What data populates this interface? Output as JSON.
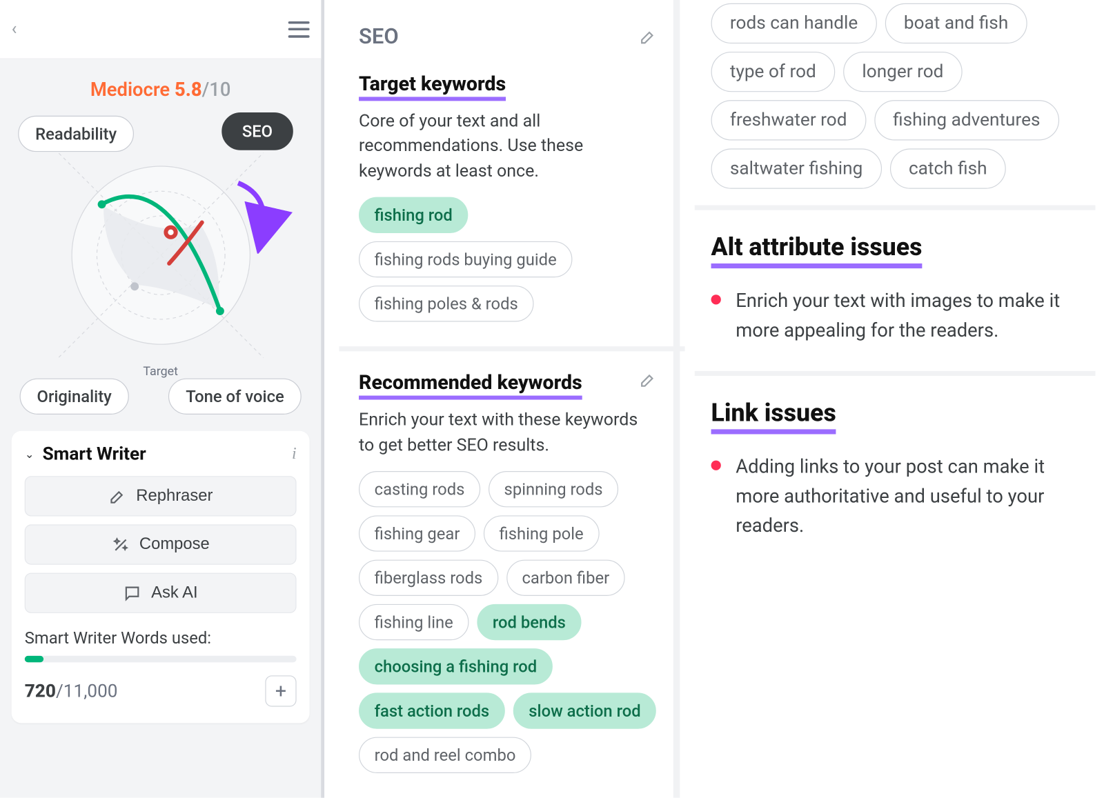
{
  "score": {
    "label": "Mediocre",
    "value": "5.8",
    "max": "/10"
  },
  "tabs": {
    "readability": "Readability",
    "seo": "SEO",
    "originality": "Originality",
    "tone": "Tone of voice"
  },
  "radar": {
    "target_label": "Target"
  },
  "smart_writer": {
    "title": "Smart Writer",
    "rephraser": "Rephraser",
    "compose": "Compose",
    "ask_ai": "Ask AI",
    "usage_label": "Smart Writer Words used:",
    "used": "720",
    "limit": "/11,000"
  },
  "middle": {
    "panel_title": "SEO",
    "target": {
      "title": "Target keywords",
      "desc": "Core of your text and all recommendations. Use these keywords at least once.",
      "keywords": [
        {
          "label": "fishing rod",
          "active": true
        },
        {
          "label": "fishing rods buying guide",
          "active": false
        },
        {
          "label": "fishing poles & rods",
          "active": false
        }
      ]
    },
    "recommended": {
      "title": "Recommended keywords",
      "desc": "Enrich your text with these keywords to get better SEO results.",
      "keywords": [
        {
          "label": "casting rods",
          "active": false
        },
        {
          "label": "spinning rods",
          "active": false
        },
        {
          "label": "fishing gear",
          "active": false
        },
        {
          "label": "fishing pole",
          "active": false
        },
        {
          "label": "fiberglass rods",
          "active": false
        },
        {
          "label": "carbon fiber",
          "active": false
        },
        {
          "label": "fishing line",
          "active": false
        },
        {
          "label": "rod bends",
          "active": true
        },
        {
          "label": "choosing a fishing rod",
          "active": true
        },
        {
          "label": "fast action rods",
          "active": true
        },
        {
          "label": "slow action rod",
          "active": true
        },
        {
          "label": "rod and reel combo",
          "active": false
        }
      ]
    }
  },
  "right": {
    "extra_keywords": [
      "rods can handle",
      "boat and fish",
      "type of rod",
      "longer rod",
      "freshwater rod",
      "fishing adventures",
      "saltwater fishing",
      "catch fish"
    ],
    "alt": {
      "title": "Alt attribute issues",
      "text": "Enrich your text with images to make it more appealing for the readers."
    },
    "link": {
      "title": "Link issues",
      "text": "Adding links to your post can make it more authoritative and useful to your readers."
    }
  },
  "chart_data": {
    "type": "radar",
    "axes": [
      "Readability",
      "SEO",
      "Originality",
      "Tone of voice"
    ],
    "target": [
      1.0,
      1.0,
      1.0,
      1.0
    ],
    "values": [
      0.85,
      0.55,
      0.35,
      0.85
    ],
    "colors": {
      "good": "#00b67a",
      "bad": "#d43f3a"
    }
  }
}
